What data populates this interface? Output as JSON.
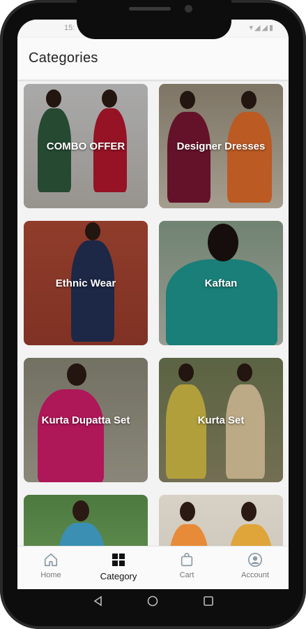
{
  "status": {
    "time": "15:",
    "icons": "▾◢◢▮"
  },
  "appbar": {
    "title": "Categories"
  },
  "categories": [
    {
      "label": "COMBO OFFER"
    },
    {
      "label": "Designer Dresses"
    },
    {
      "label": "Ethnic Wear"
    },
    {
      "label": "Kaftan"
    },
    {
      "label": "Kurta Dupatta Set"
    },
    {
      "label": "Kurta Set"
    },
    {
      "label": ""
    },
    {
      "label": ""
    }
  ],
  "bottom_nav": {
    "home": "Home",
    "category": "Category",
    "cart": "Cart",
    "account": "Account"
  },
  "icons": {
    "home": "home-icon",
    "category": "grid-icon",
    "cart": "shopping-bag-icon",
    "account": "account-icon"
  }
}
